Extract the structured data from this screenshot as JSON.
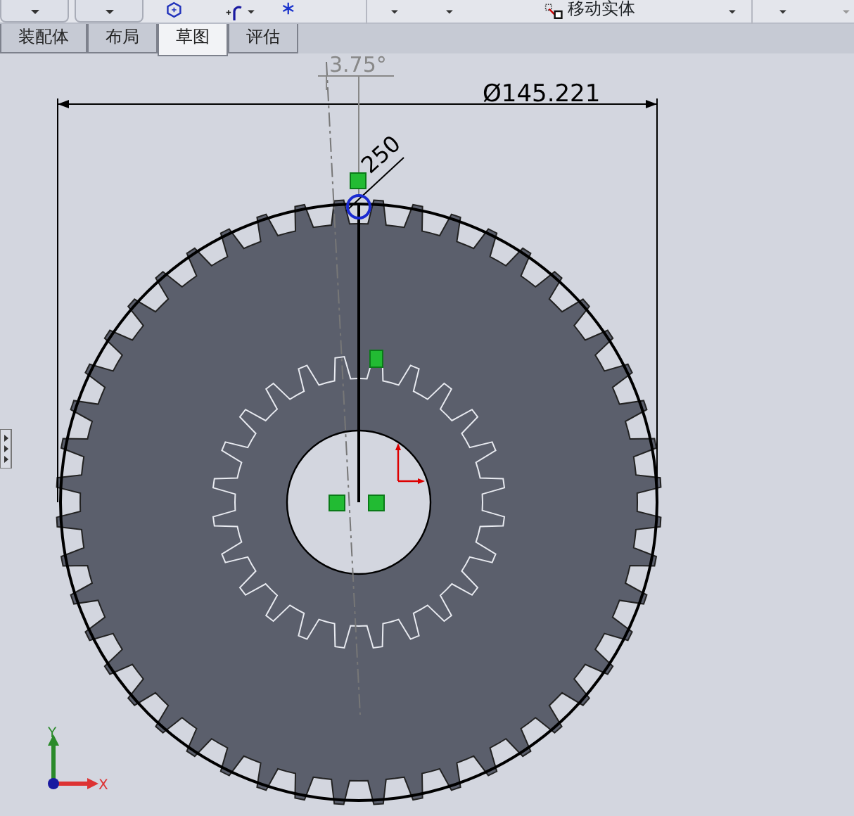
{
  "toolbar": {
    "move_label": "移动实体"
  },
  "tabs": [
    {
      "label": "装配体",
      "selected": false
    },
    {
      "label": "布局",
      "selected": false
    },
    {
      "label": "草图",
      "selected": true
    },
    {
      "label": "评估",
      "selected": false
    }
  ],
  "canvas": {
    "angle_dimension": "3.75°",
    "diameter_dimension": "Ø145.221",
    "small_dimension": "250",
    "axis_y": "Y",
    "axis_x": "X"
  }
}
